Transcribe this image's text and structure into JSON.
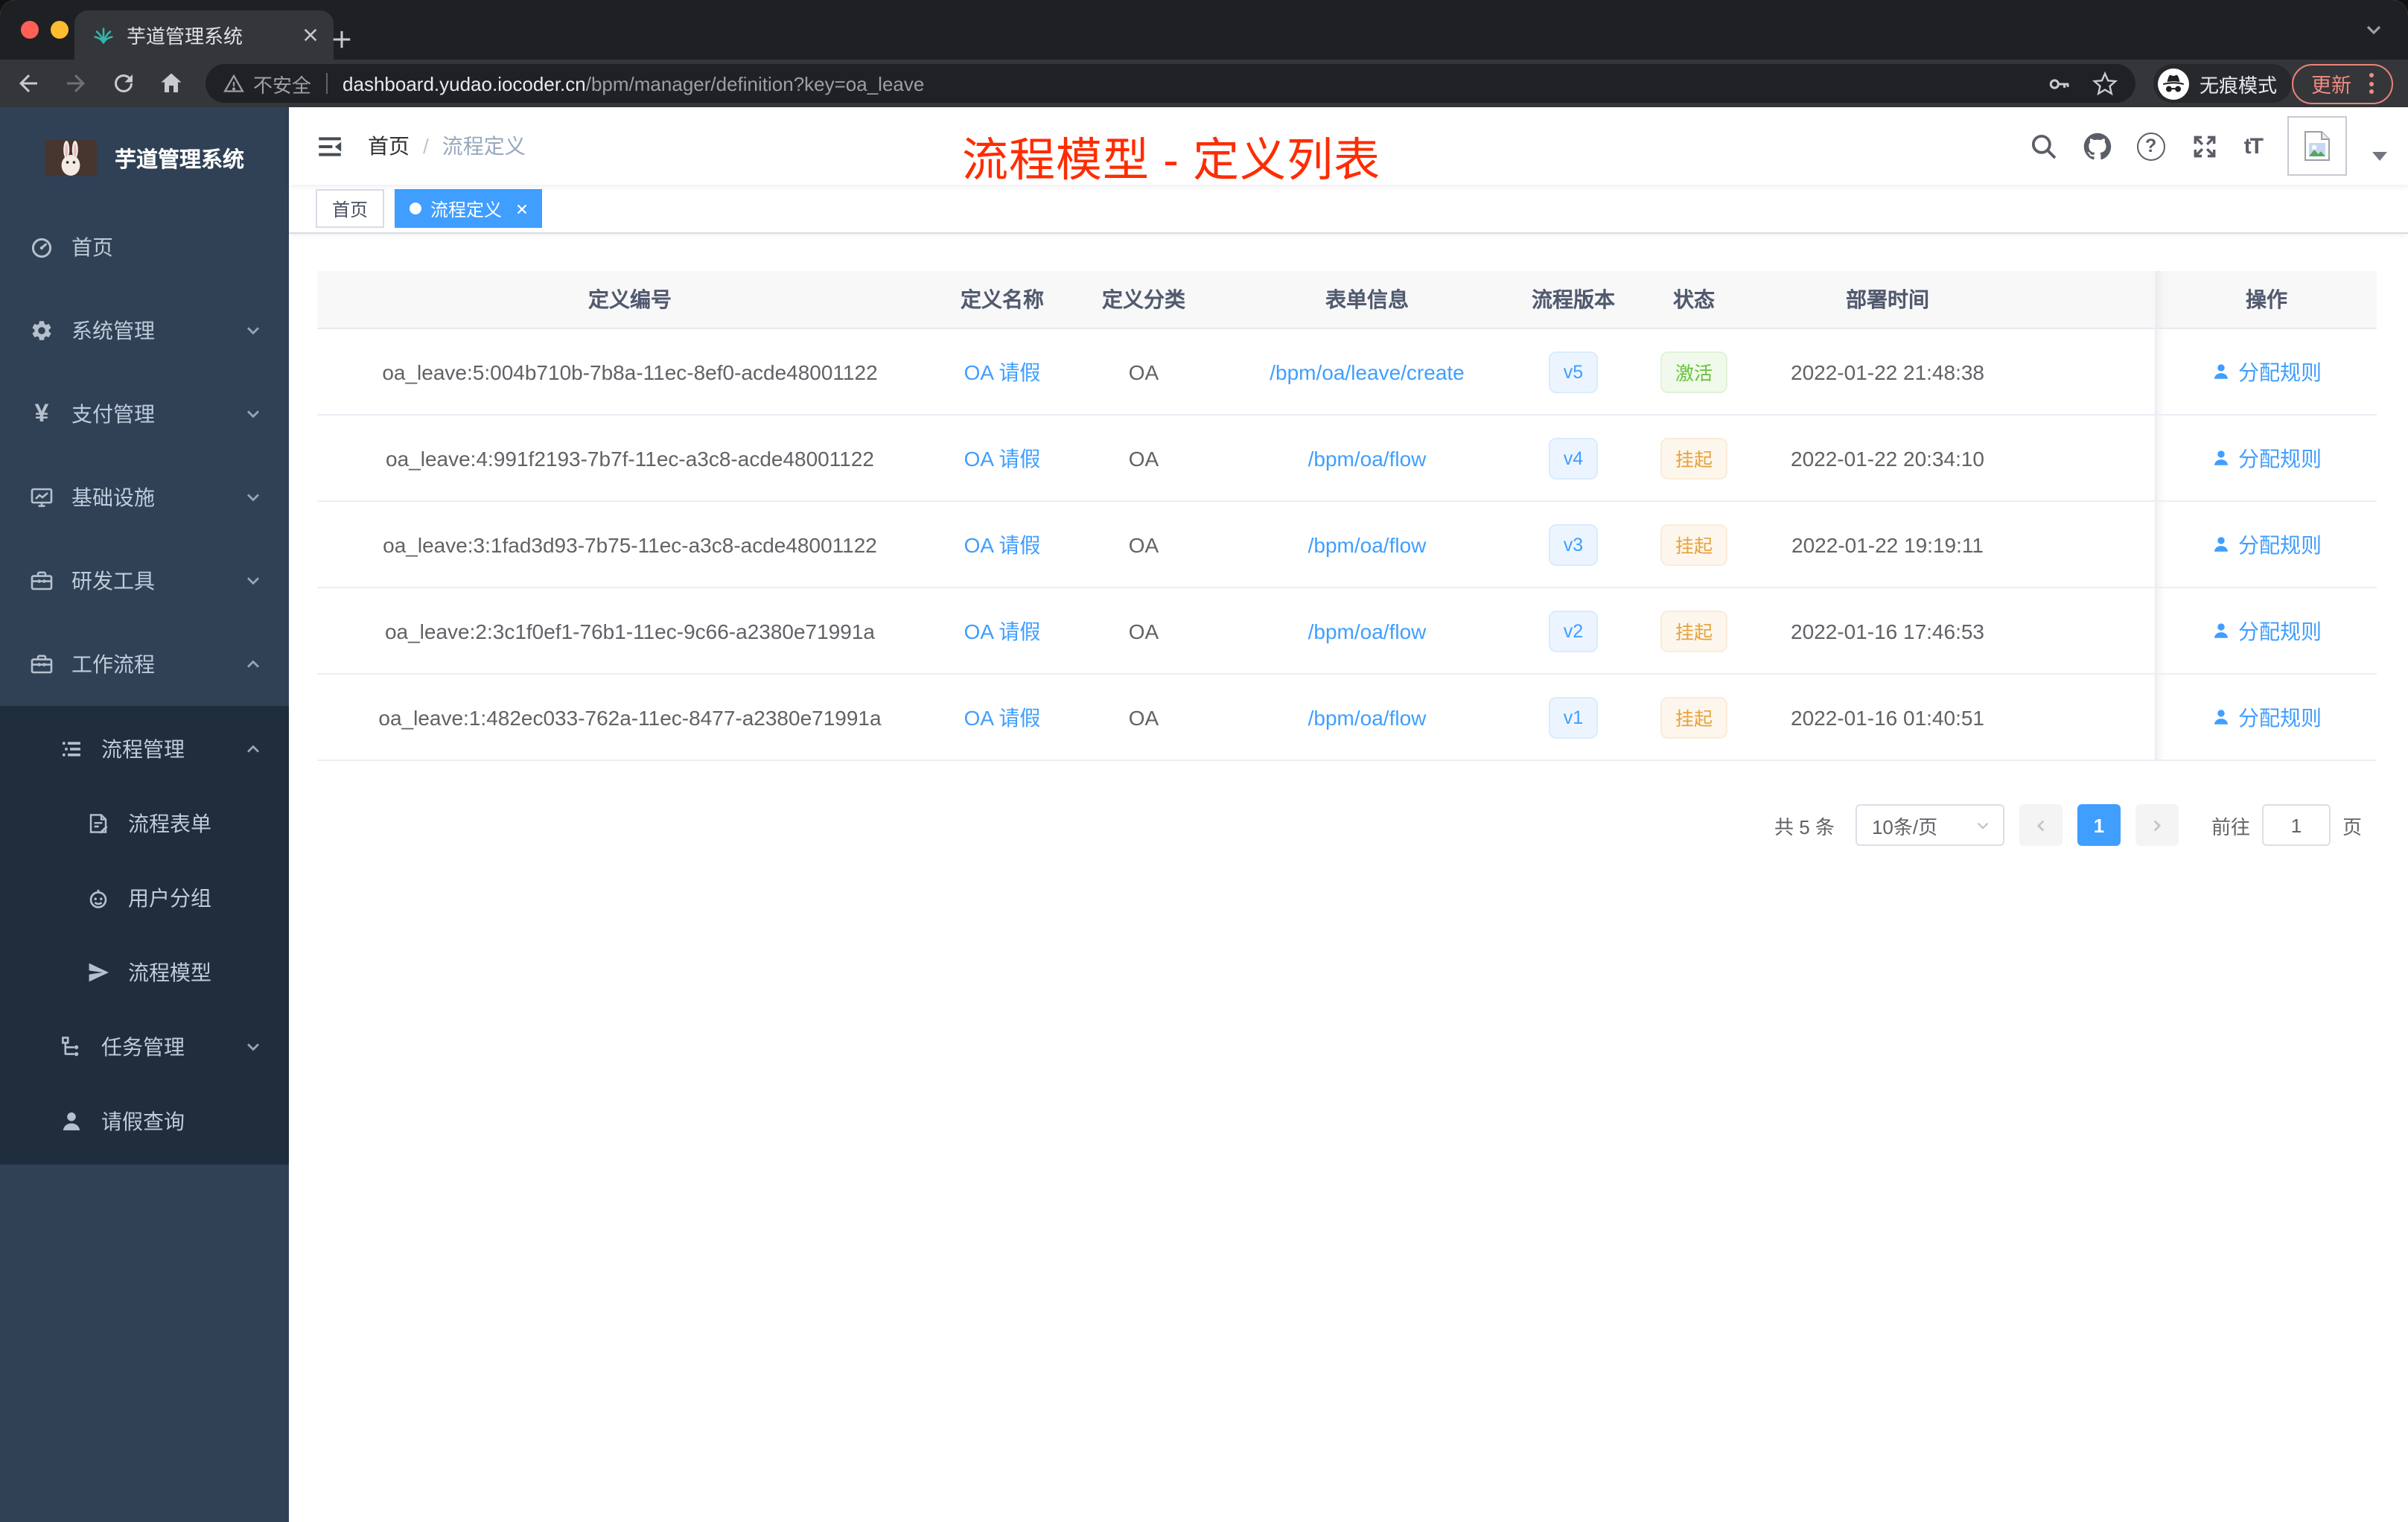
{
  "colors": {
    "accent": "#409eff",
    "success": "#67c23a",
    "warning": "#e6a23c",
    "annotation_red": "#fe2c00",
    "sidebar_bg": "#304156",
    "submenu_bg": "#1f2d3d",
    "active_tag": "#409eff",
    "update_salmon": "#f28b82"
  },
  "browser": {
    "tab": {
      "title": "芋道管理系统"
    },
    "toolbar": {
      "security_label": "不安全",
      "url_host": "dashboard.yudao.iocoder.cn",
      "url_path": "/bpm/manager/definition?key=oa_leave",
      "incognito_label": "无痕模式",
      "update_label": "更新"
    }
  },
  "sidebar": {
    "app_title": "芋道管理系统",
    "menu": [
      {
        "label": "首页"
      },
      {
        "label": "系统管理"
      },
      {
        "label": "支付管理",
        "icon_glyph": "¥"
      },
      {
        "label": "基础设施"
      },
      {
        "label": "研发工具"
      },
      {
        "label": "工作流程"
      }
    ],
    "submenu": [
      {
        "label": "流程管理"
      },
      {
        "label": "流程表单"
      },
      {
        "label": "用户分组"
      },
      {
        "label": "流程模型"
      },
      {
        "label": "任务管理"
      },
      {
        "label": "请假查询"
      }
    ]
  },
  "navbar": {
    "breadcrumb": [
      "首页",
      "流程定义"
    ],
    "breadcrumb_separator": "/",
    "annotation": "流程模型 - 定义列表",
    "help_glyph": "?",
    "fontsize_glyph": "tT"
  },
  "tags": [
    {
      "label": "首页"
    },
    {
      "label": "流程定义"
    }
  ],
  "table": {
    "columns": [
      "定义编号",
      "定义名称",
      "定义分类",
      "表单信息",
      "流程版本",
      "状态",
      "部署时间",
      "操作"
    ],
    "rows": [
      {
        "id": "oa_leave:5:004b710b-7b8a-11ec-8ef0-acde48001122",
        "name": "OA 请假",
        "category": "OA",
        "form": "/bpm/oa/leave/create",
        "version": "v5",
        "status": "激活",
        "status_type": "success",
        "deployed_at": "2022-01-22 21:48:38",
        "action": "分配规则"
      },
      {
        "id": "oa_leave:4:991f2193-7b7f-11ec-a3c8-acde48001122",
        "name": "OA 请假",
        "category": "OA",
        "form": "/bpm/oa/flow",
        "version": "v4",
        "status": "挂起",
        "status_type": "warning",
        "deployed_at": "2022-01-22 20:34:10",
        "action": "分配规则"
      },
      {
        "id": "oa_leave:3:1fad3d93-7b75-11ec-a3c8-acde48001122",
        "name": "OA 请假",
        "category": "OA",
        "form": "/bpm/oa/flow",
        "version": "v3",
        "status": "挂起",
        "status_type": "warning",
        "deployed_at": "2022-01-22 19:19:11",
        "action": "分配规则"
      },
      {
        "id": "oa_leave:2:3c1f0ef1-76b1-11ec-9c66-a2380e71991a",
        "name": "OA 请假",
        "category": "OA",
        "form": "/bpm/oa/flow",
        "version": "v2",
        "status": "挂起",
        "status_type": "warning",
        "deployed_at": "2022-01-16 17:46:53",
        "action": "分配规则"
      },
      {
        "id": "oa_leave:1:482ec033-762a-11ec-8477-a2380e71991a",
        "name": "OA 请假",
        "category": "OA",
        "form": "/bpm/oa/flow",
        "version": "v1",
        "status": "挂起",
        "status_type": "warning",
        "deployed_at": "2022-01-16 01:40:51",
        "action": "分配规则"
      }
    ]
  },
  "pagination": {
    "total_label": "共 5 条",
    "page_size": "10条/页",
    "current_page": "1",
    "goto_label": "前往",
    "page_unit_label": "页"
  }
}
